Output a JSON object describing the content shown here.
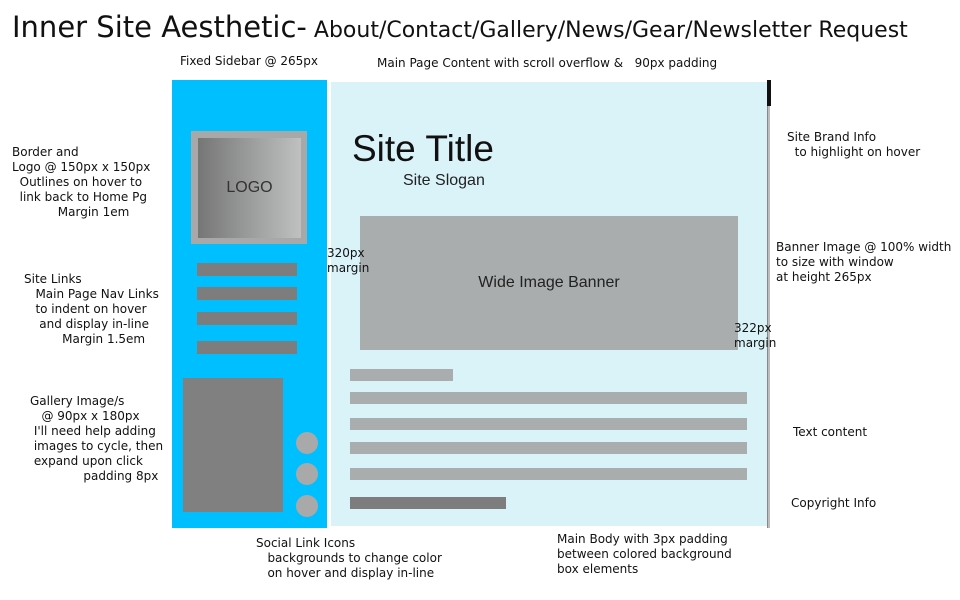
{
  "title": {
    "main": "Inner Site Aesthetic-",
    "pages": " About/Contact/Gallery/News/Gear/Newsletter Request"
  },
  "annotations": {
    "sidebar": "Fixed Sidebar @ 265px",
    "main_content": "Main Page Content with scroll overflow &   90px padding",
    "logo": "Border and\nLogo @ 150px x 150px\n  Outlines on hover to\n  link back to Home Pg\n            Margin 1em",
    "site_links": "Site Links\n   Main Page Nav Links\n   to indent on hover\n    and display in-line\n          Margin 1.5em",
    "gallery": "Gallery Image/s\n   @ 90px x 180px\n I'll need help adding\n images to cycle, then\n expand upon click\n              padding 8px",
    "margin_left": "320px\nmargin",
    "margin_right": "322px\nmargin",
    "brand": "Site Brand Info\n  to highlight on hover",
    "banner_note": "Banner Image @ 100% width\nto size with window\nat height 265px",
    "text_content": "Text content",
    "copyright_note": "Copyright Info",
    "social": "Social Link Icons\n   backgrounds to change color\n   on hover and display in-line",
    "main_body": "Main Body with 3px padding\nbetween colored background\nbox elements"
  },
  "wireframe": {
    "logo_label": "LOGO",
    "site_title": "Site Title",
    "site_slogan": "Site Slogan",
    "banner_label": "Wide Image Banner"
  },
  "colors": {
    "sidebar": "#00bfff",
    "main": "#daf3f9",
    "placeholder_light": "#a9adad",
    "placeholder_dark": "#7d7d7d"
  }
}
